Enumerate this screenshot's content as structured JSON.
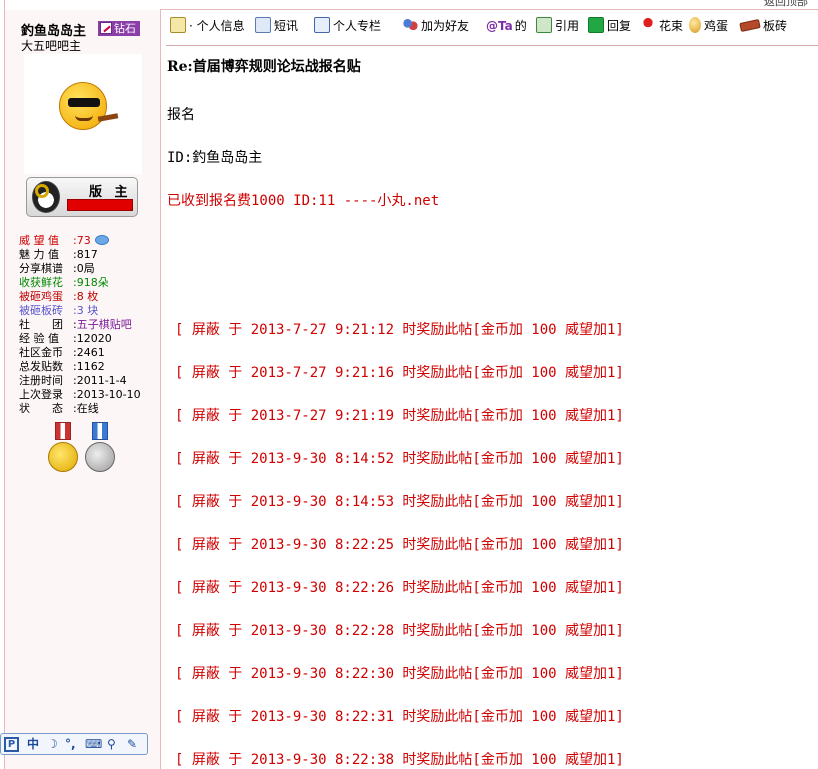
{
  "top_strip": {
    "partial_text": "返回顶部"
  },
  "user": {
    "name": "釣鱼岛岛主",
    "rank": "钻石",
    "group": "大五吧吧主",
    "badge_label": "版 主",
    "medals": 2
  },
  "stats": [
    {
      "label": "威 望 值",
      "value": "73",
      "color": "#d00000",
      "has_icon": true
    },
    {
      "label": "魅 力 值",
      "value": "817"
    },
    {
      "label": "分享棋谱",
      "value": "0局"
    },
    {
      "label": "收获鲜花",
      "value": "918朵",
      "color": "#008800"
    },
    {
      "label": "被砸鸡蛋",
      "value": "8 枚",
      "color": "#c00000"
    },
    {
      "label": "被砸板砖",
      "value": "3 块",
      "color": "#5555cc"
    },
    {
      "label": "社　　团",
      "value": "五子棋贴吧",
      "value_color": "#7a1b9a"
    },
    {
      "label": "经 验 值",
      "value": "12020"
    },
    {
      "label": "社区金币",
      "value": "2461"
    },
    {
      "label": "总发贴数",
      "value": "1162"
    },
    {
      "label": "注册时间",
      "value": "2011-1-4"
    },
    {
      "label": "上次登录",
      "value": "2013-10-10"
    },
    {
      "label": "状　　态",
      "value": "在线"
    }
  ],
  "toolbar": {
    "profile": "· 个人信息",
    "pm": "短讯",
    "blog": "个人专栏",
    "add_friend": "加为好友",
    "at_icon": "@Ta",
    "at_suffix": "的",
    "quote": "引用",
    "reply": "回复",
    "flower": "花束",
    "egg": "鸡蛋",
    "brick": "板砖"
  },
  "post": {
    "title": "Re:首届博弈规则论坛战报名贴",
    "lines": [
      "报名",
      "ID:釣鱼岛岛主"
    ],
    "fee_line": "已收到报名费1000  ID:11  ----小丸.net"
  },
  "notices": [
    "[ 屏蔽 于 2013-7-27 9:21:12 时奖励此帖[金币加 100 威望加1]",
    "[ 屏蔽 于 2013-7-27 9:21:16 时奖励此帖[金币加 100 威望加1]",
    "[ 屏蔽 于 2013-7-27 9:21:19 时奖励此帖[金币加 100 威望加1]",
    "[ 屏蔽 于 2013-9-30 8:14:52 时奖励此帖[金币加 100 威望加1]",
    "[ 屏蔽 于 2013-9-30 8:14:53 时奖励此帖[金币加 100 威望加1]",
    "[ 屏蔽 于 2013-9-30 8:22:25 时奖励此帖[金币加 100 威望加1]",
    "[ 屏蔽 于 2013-9-30 8:22:26 时奖励此帖[金币加 100 威望加1]",
    "[ 屏蔽 于 2013-9-30 8:22:28 时奖励此帖[金币加 100 威望加1]",
    "[ 屏蔽 于 2013-9-30 8:22:30 时奖励此帖[金币加 100 威望加1]",
    "[ 屏蔽 于 2013-9-30 8:22:31 时奖励此帖[金币加 100 威望加1]",
    "[ 屏蔽 于 2013-9-30 8:22:38 时奖励此帖[金币加 100 威望加1]"
  ],
  "ime": {
    "logo": "P",
    "mode": "中",
    "items": [
      "☽",
      "°,",
      "⌨",
      "⚲",
      "✎"
    ]
  }
}
